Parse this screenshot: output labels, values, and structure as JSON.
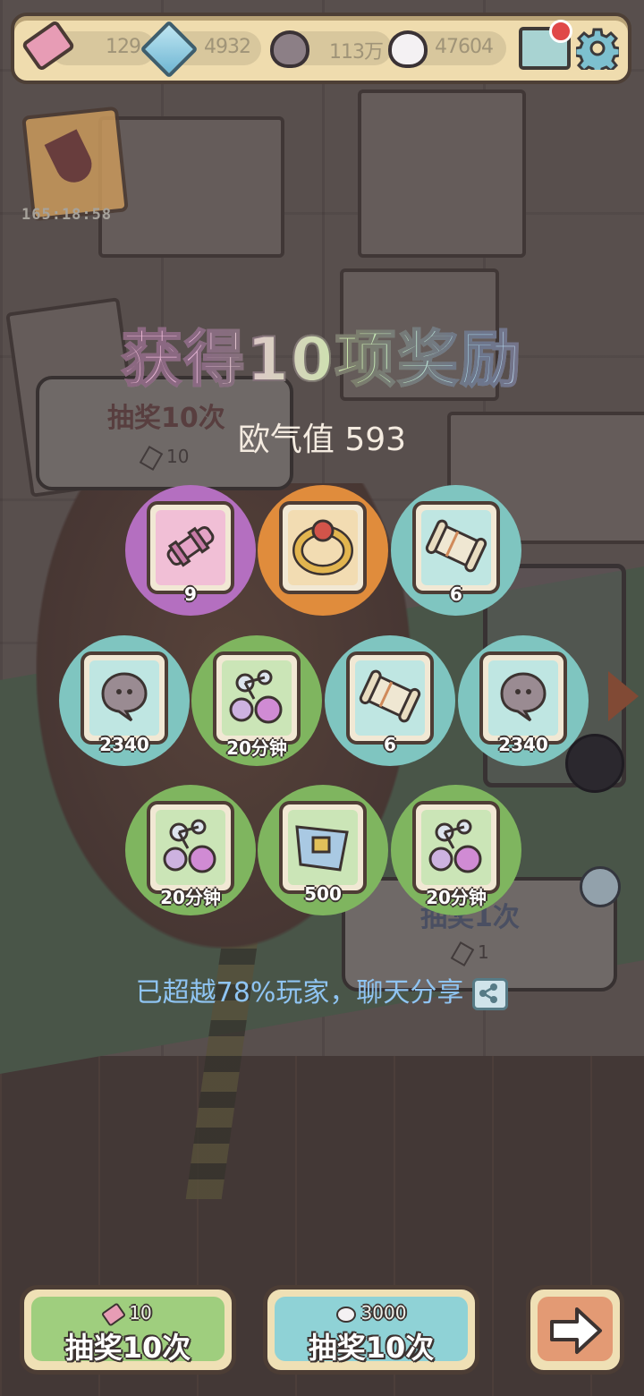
{
  "resources": {
    "tickets": "129",
    "gems": "4932",
    "ghost_coins": "113万",
    "spirits": "47604"
  },
  "event": {
    "timer": "165:18:58"
  },
  "background_signs": {
    "draw_ten_label": "抽奖10次",
    "draw_ten_cost": "10",
    "draw_one_label": "抽奖1次",
    "draw_one_cost": "1"
  },
  "reward_panel": {
    "title": "获得10项奖励",
    "luck_label": "欧气值",
    "luck_value": "593",
    "share_text": "已超越78%玩家，聊天分享"
  },
  "rewards": [
    {
      "name": "pink-cannon-item",
      "qty": "9",
      "rarity": "purple",
      "color": "#b46fc0"
    },
    {
      "name": "golden-ring-item",
      "qty": "",
      "rarity": "orange",
      "color": "#e08c3c"
    },
    {
      "name": "scroll-item",
      "qty": "6",
      "rarity": "cyan",
      "color": "#7fc5c0"
    },
    {
      "name": "ghost-coin-item",
      "qty": "2340",
      "rarity": "cyan",
      "color": "#7fc5c0"
    },
    {
      "name": "potion-flask-item",
      "qty": "20分钟",
      "rarity": "green",
      "color": "#7fb55f"
    },
    {
      "name": "scroll-item",
      "qty": "6",
      "rarity": "cyan",
      "color": "#7fc5c0"
    },
    {
      "name": "ghost-coin-item",
      "qty": "2340",
      "rarity": "cyan",
      "color": "#7fc5c0"
    },
    {
      "name": "potion-flask-item",
      "qty": "20分钟",
      "rarity": "green",
      "color": "#7fb55f"
    },
    {
      "name": "gem-pack-item",
      "qty": "500",
      "rarity": "green",
      "color": "#7fb55f"
    },
    {
      "name": "potion-flask-item",
      "qty": "20分钟",
      "rarity": "green",
      "color": "#7fb55f"
    }
  ],
  "buttons": {
    "draw_ten_ticket": {
      "cost": "10",
      "label": "抽奖10次"
    },
    "draw_ten_coin": {
      "cost": "3000",
      "label": "抽奖10次"
    },
    "next": {
      "icon": "arrow-right-icon"
    }
  }
}
